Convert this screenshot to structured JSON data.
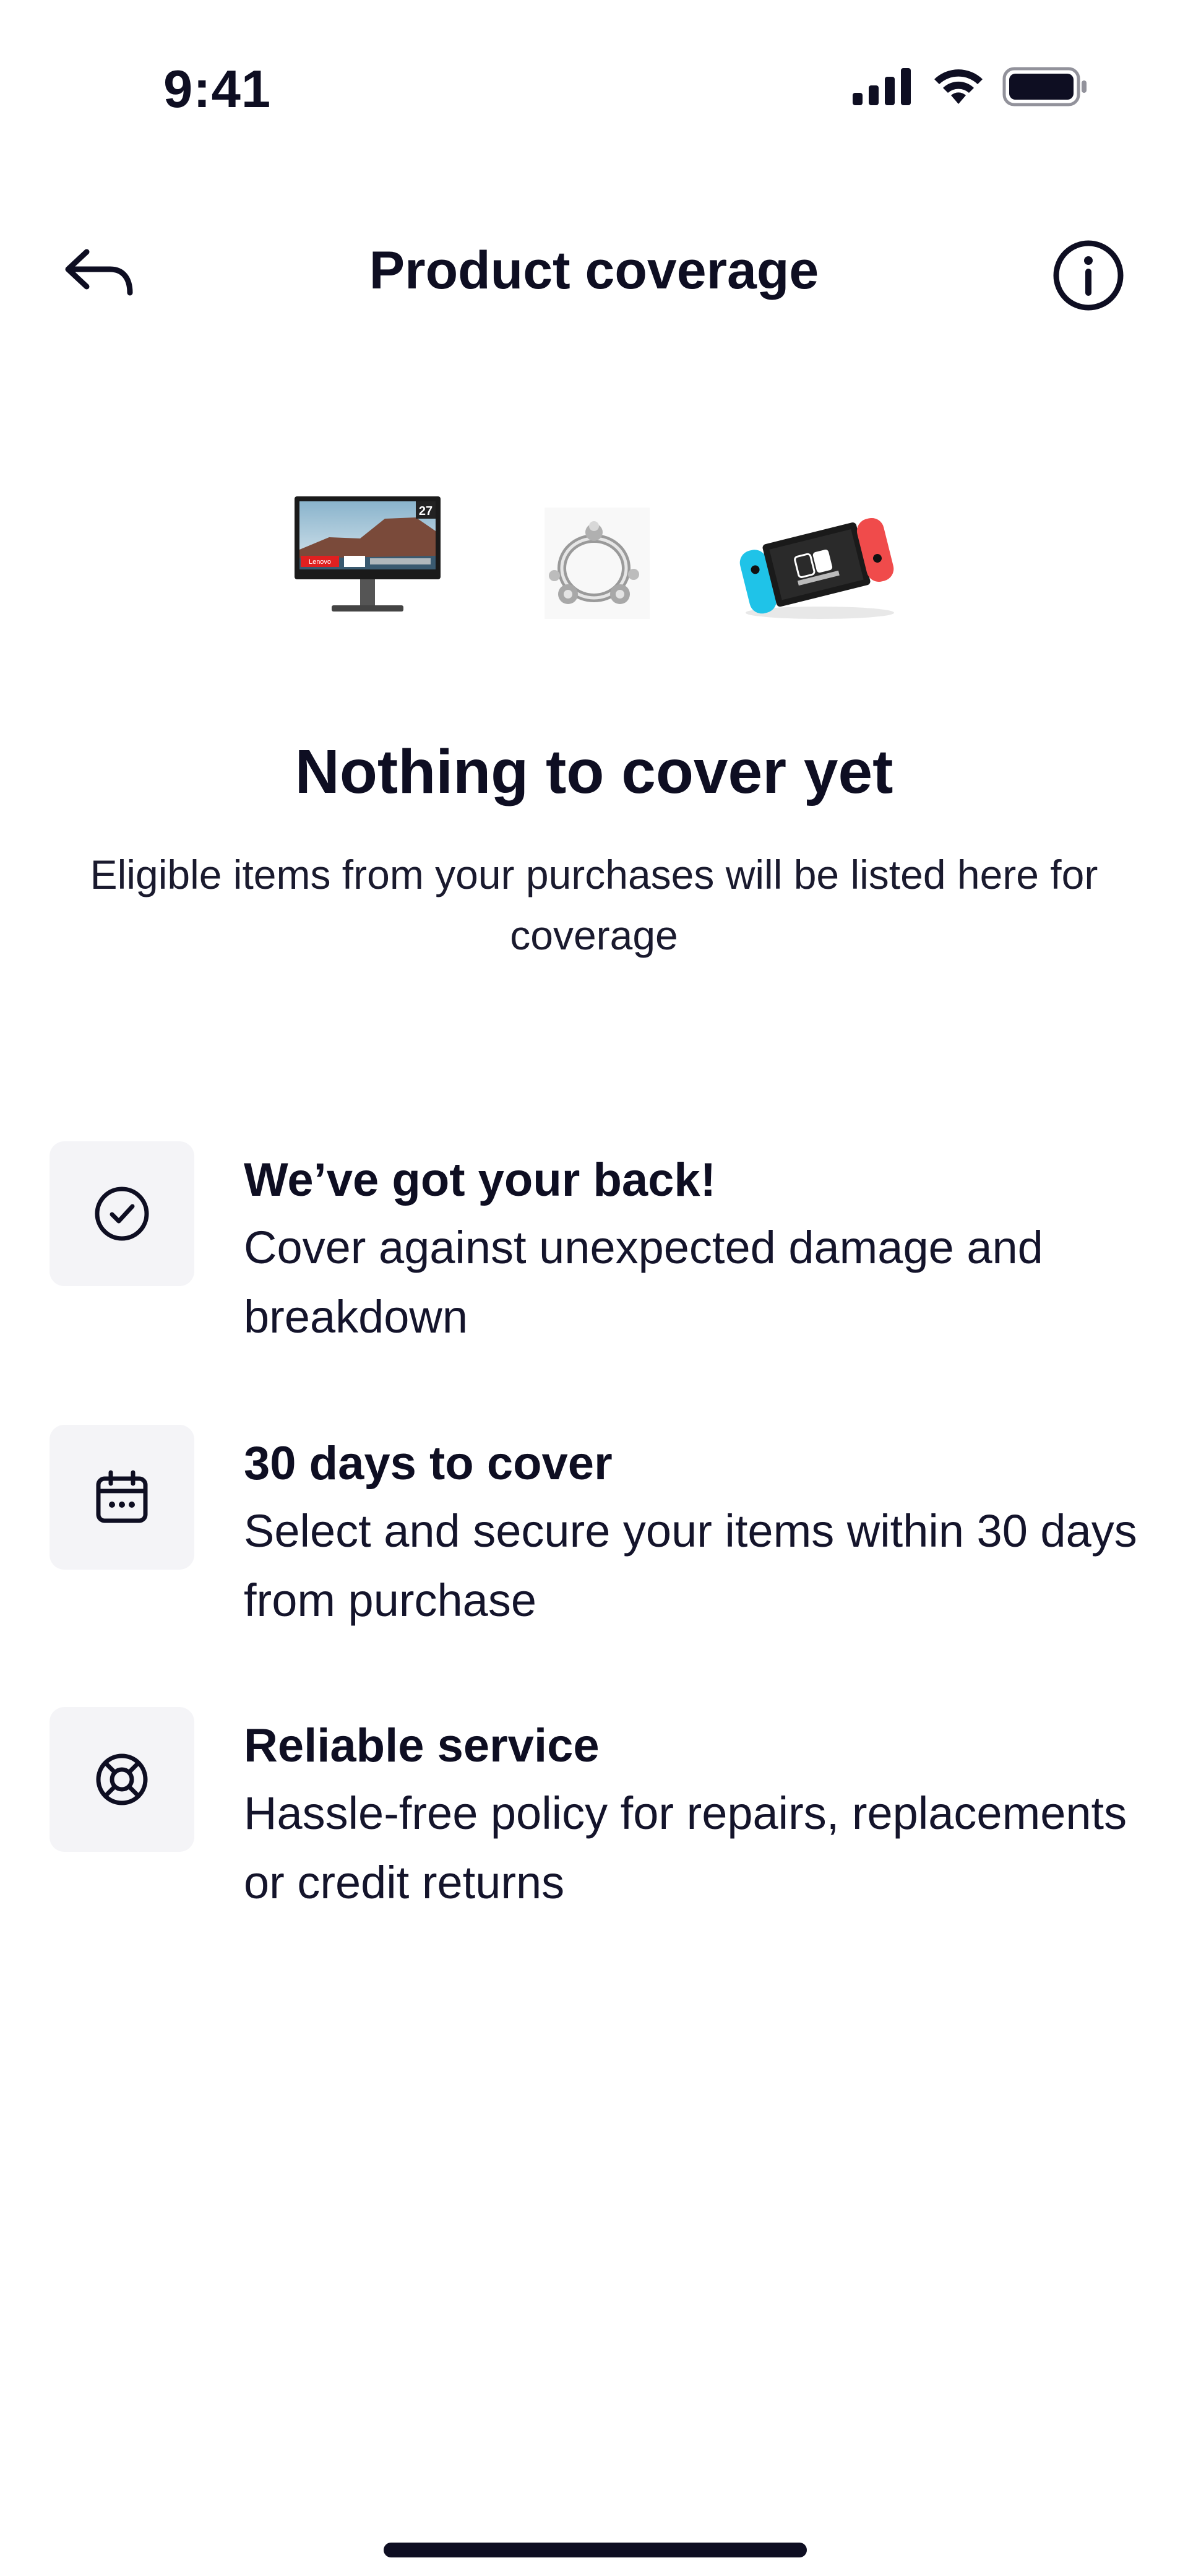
{
  "status_bar": {
    "time": "9:41",
    "icons": [
      "cellular-signal-icon",
      "wifi-icon",
      "battery-icon"
    ]
  },
  "nav": {
    "title": "Product coverage",
    "back_icon": "back-arrow-icon",
    "info_icon": "info-icon"
  },
  "products": [
    {
      "name": "monitor-image",
      "monitor_badge": "27",
      "brand_label": "Lenovo"
    },
    {
      "name": "charm-image"
    },
    {
      "name": "game-console-image"
    }
  ],
  "empty_state": {
    "title": "Nothing to cover yet",
    "description": "Eligible items from your purchases will be listed here for coverage"
  },
  "features": [
    {
      "icon": "check-circle-icon",
      "title": "We’ve got your back!",
      "description": "Cover against unexpected damage and breakdown"
    },
    {
      "icon": "calendar-icon",
      "title": "30 days to cover",
      "description": "Select and secure your items within 30 days from purchase"
    },
    {
      "icon": "lifebuoy-icon",
      "title": "Reliable service",
      "description": "Hassle-free policy for repairs, replacements or credit returns"
    }
  ],
  "colors": {
    "text_primary": "#0e0e22",
    "icon_box_bg": "#f4f4f7",
    "background": "#ffffff",
    "console_left": "#1fc3e8",
    "console_right": "#f04b4b"
  }
}
